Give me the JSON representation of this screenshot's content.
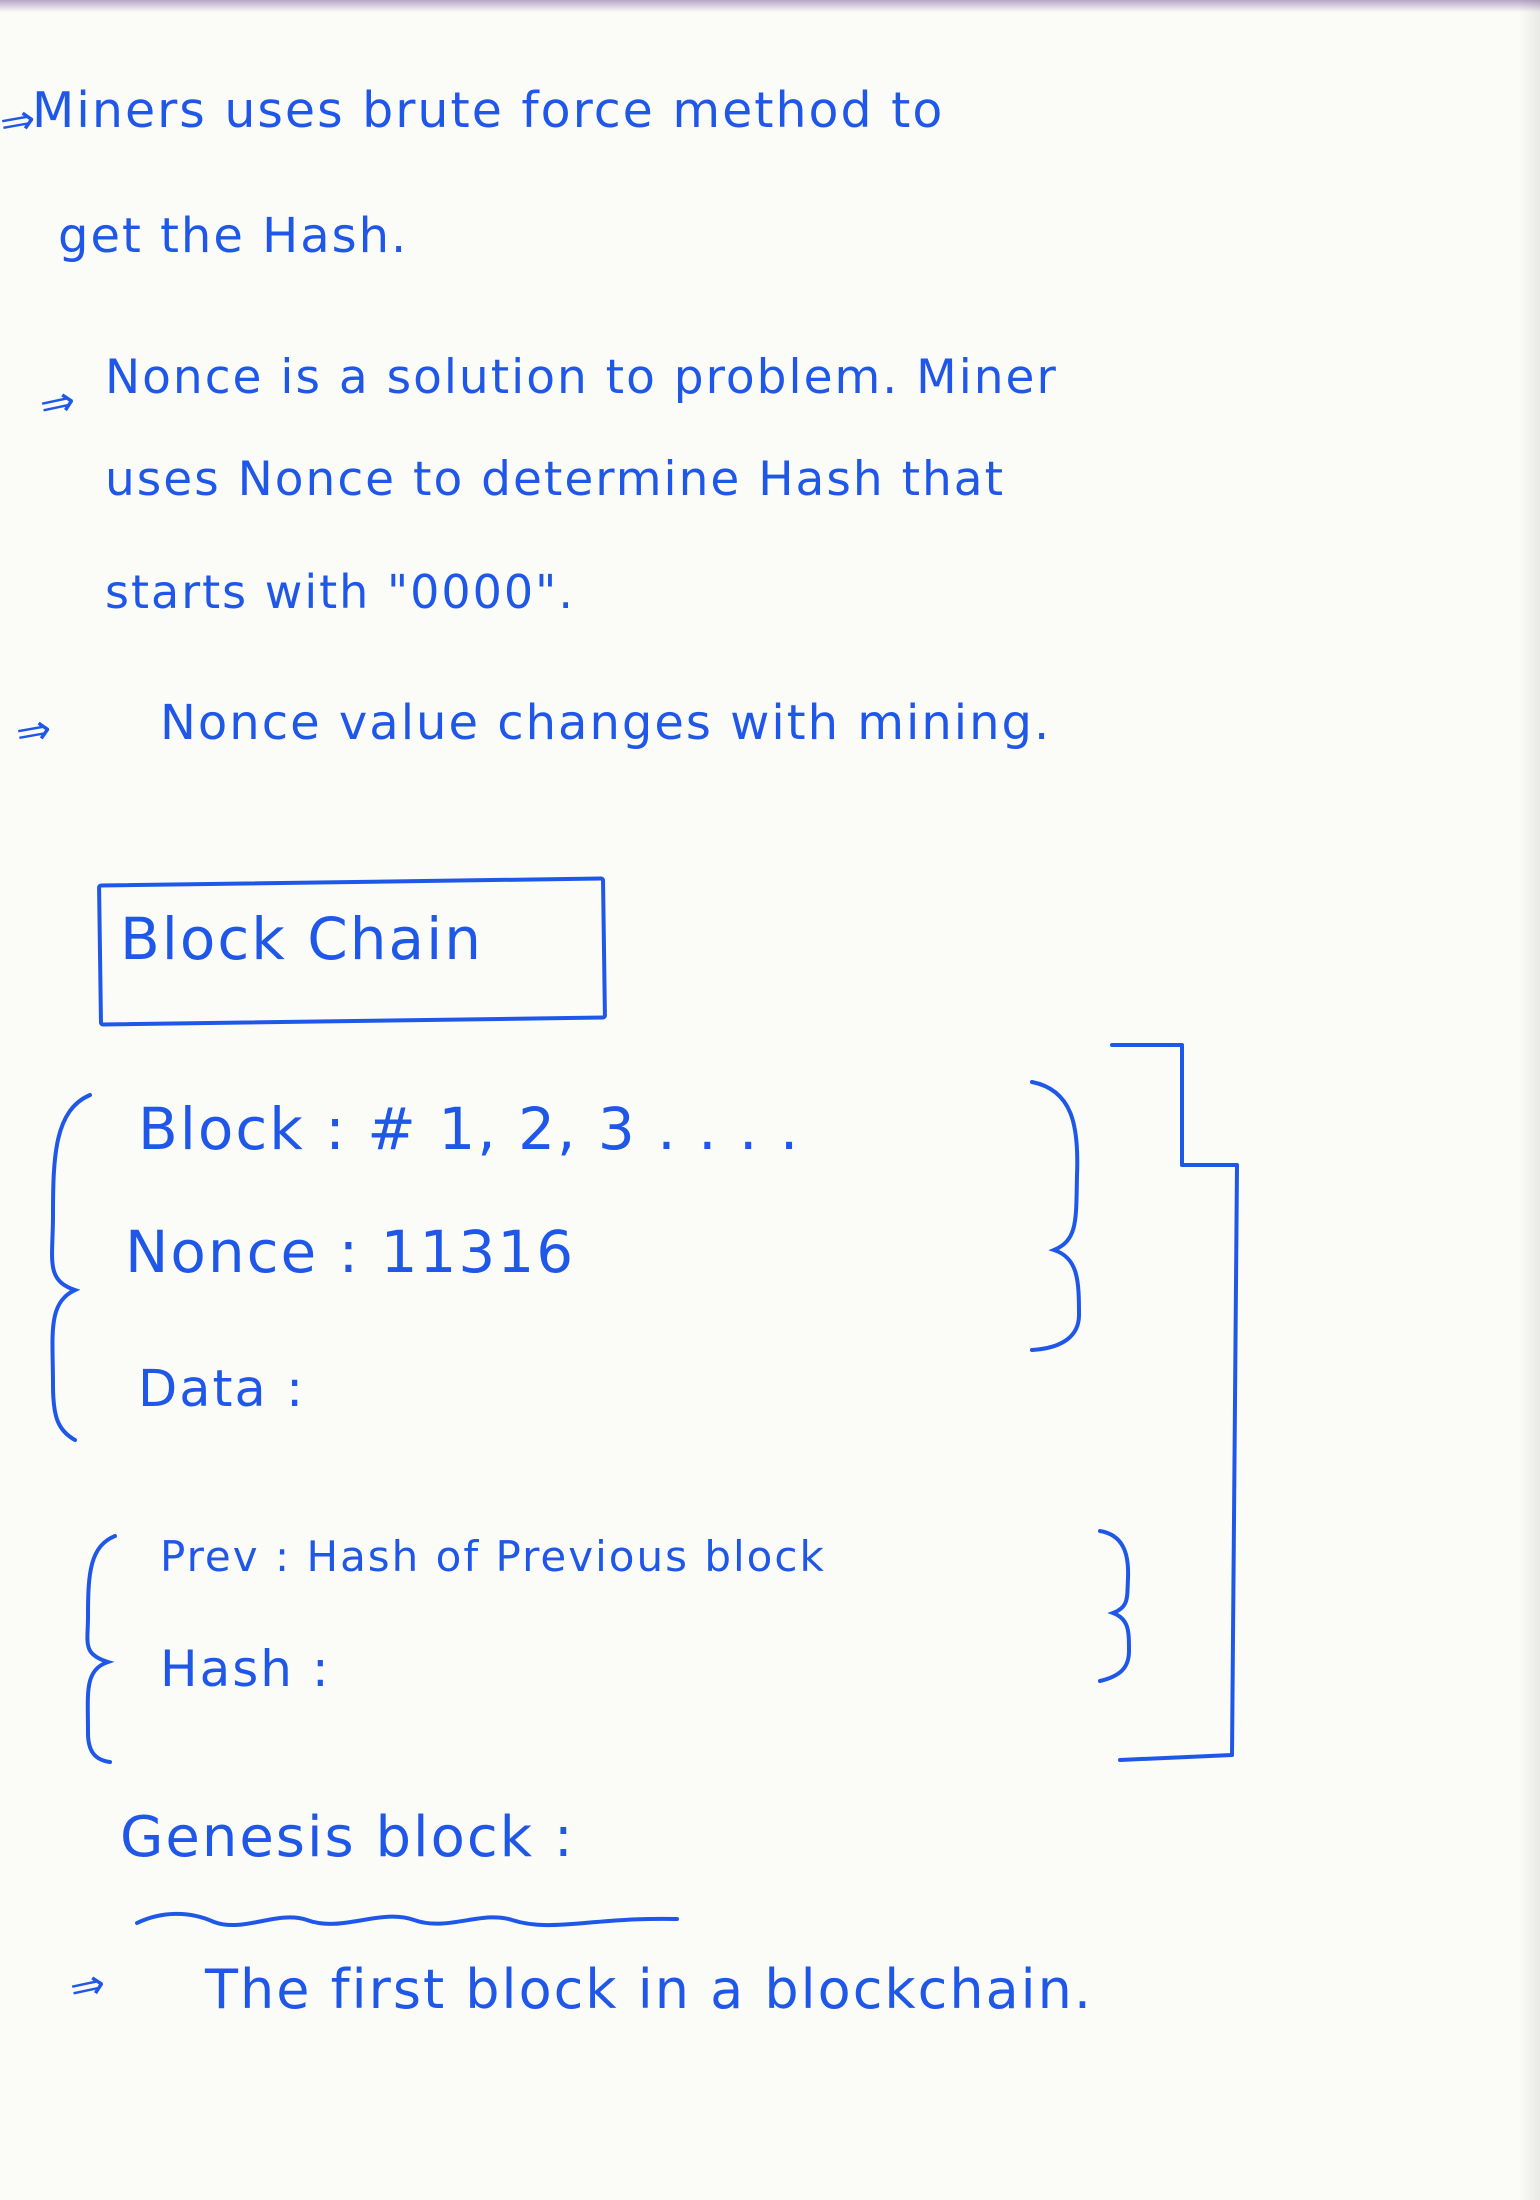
{
  "notes": {
    "line_1": "Miners uses brute force method to",
    "line_2": "get the Hash.",
    "line_3": "Nonce is a solution to problem. Miner",
    "line_4": "uses Nonce to determine Hash that",
    "line_5": "starts with \"0000\".",
    "line_6": "Nonce value changes with mining."
  },
  "blockchain": {
    "title": "Block Chain",
    "block_line": "Block : # 1, 2, 3 . . . .",
    "nonce_line": "Nonce : 11316",
    "data_line": "Data :",
    "prev_line": "Prev : Hash of Previous block",
    "hash_line": "Hash :"
  },
  "genesis": {
    "title": "Genesis block :",
    "definition": "The first block in a blockchain."
  },
  "icons": {
    "bullet_arrow": "arrow-icon",
    "bracket": "brace-icon"
  },
  "colors": {
    "ink": "#1f57e8",
    "paper": "#fbfbf8",
    "top_edge": "#b8a6c7"
  }
}
